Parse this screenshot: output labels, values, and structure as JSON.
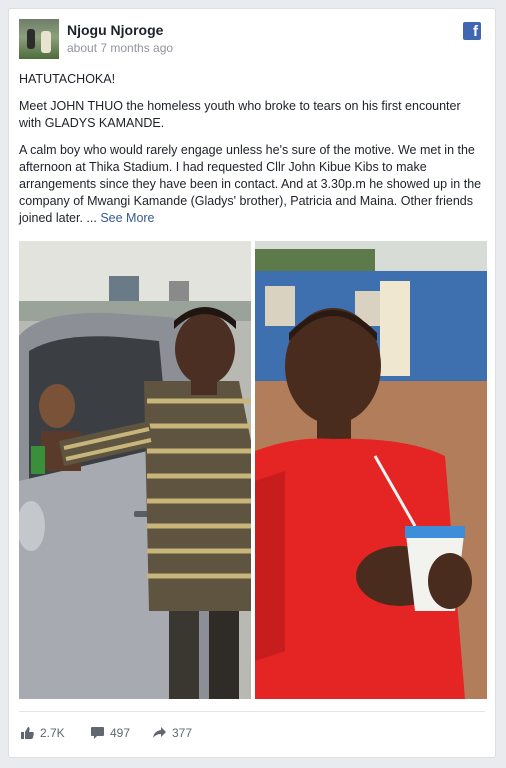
{
  "post": {
    "author": "Njogu Njoroge",
    "timestamp": "about 7 months ago",
    "paragraphs": [
      "HATUTACHOKA!",
      "Meet JOHN THUO the homeless youth who broke to tears on his first encounter with GLADYS KAMANDE.",
      "A calm boy who would rarely engage unless he's sure of the motive. We met in the afternoon at Thika Stadium. I had requested Cllr John Kibue Kibs to make arrangements since they have been in contact. And at 3.30p.m he showed up in the company of Mwangi Kamande (Gladys' brother), Patricia and Maina. Other friends joined later. ..."
    ],
    "see_more": "See More",
    "platform_logo": "f"
  },
  "engagement": {
    "likes": "2.7K",
    "comments": "497",
    "shares": "377"
  },
  "icons": {
    "platform": "facebook-logo-icon",
    "likes": "thumbs-up-icon",
    "comments": "comment-bubble-icon",
    "shares": "share-arrow-icon"
  },
  "colors": {
    "facebook_blue": "#4267b2",
    "link": "#385898",
    "muted": "#90949c"
  }
}
